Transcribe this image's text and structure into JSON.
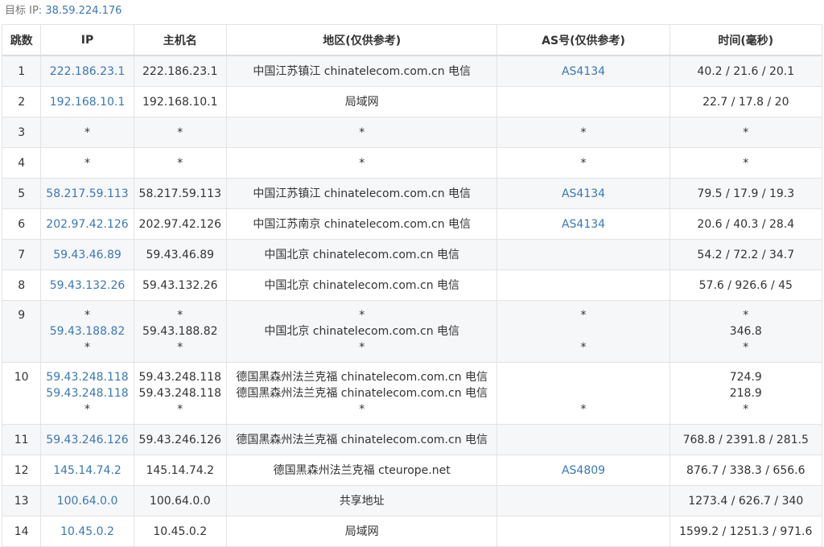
{
  "target": {
    "label": "目标 IP:",
    "ip": "38.59.224.176"
  },
  "columns": {
    "hop": "跳数",
    "ip": "IP",
    "host": "主机名",
    "region": "地区(仅供参考)",
    "as": "AS号(仅供参考)",
    "time": "时间(毫秒)"
  },
  "hops": [
    {
      "hop": "1",
      "lines": [
        {
          "ip": "222.186.23.1",
          "host": "222.186.23.1",
          "region": "中国江苏镇江 chinatelecom.com.cn 电信",
          "as": "AS4134",
          "time": "40.2 / 21.6 / 20.1"
        }
      ]
    },
    {
      "hop": "2",
      "lines": [
        {
          "ip": "192.168.10.1",
          "host": "192.168.10.1",
          "region": "局域网",
          "as": "",
          "time": "22.7 / 17.8 / 20"
        }
      ]
    },
    {
      "hop": "3",
      "lines": [
        {
          "ip": "*",
          "host": "*",
          "region": "*",
          "as": "*",
          "time": "*"
        }
      ]
    },
    {
      "hop": "4",
      "lines": [
        {
          "ip": "*",
          "host": "*",
          "region": "*",
          "as": "*",
          "time": "*"
        }
      ]
    },
    {
      "hop": "5",
      "lines": [
        {
          "ip": "58.217.59.113",
          "host": "58.217.59.113",
          "region": "中国江苏镇江 chinatelecom.com.cn 电信",
          "as": "AS4134",
          "time": "79.5 / 17.9 / 19.3"
        }
      ]
    },
    {
      "hop": "6",
      "lines": [
        {
          "ip": "202.97.42.126",
          "host": "202.97.42.126",
          "region": "中国江苏南京 chinatelecom.com.cn 电信",
          "as": "AS4134",
          "time": "20.6 / 40.3 / 28.4"
        }
      ]
    },
    {
      "hop": "7",
      "lines": [
        {
          "ip": "59.43.46.89",
          "host": "59.43.46.89",
          "region": "中国北京 chinatelecom.com.cn 电信",
          "as": "",
          "time": "54.2 / 72.2 / 34.7"
        }
      ]
    },
    {
      "hop": "8",
      "lines": [
        {
          "ip": "59.43.132.26",
          "host": "59.43.132.26",
          "region": "中国北京 chinatelecom.com.cn 电信",
          "as": "",
          "time": "57.6 / 926.6 / 45"
        }
      ]
    },
    {
      "hop": "9",
      "lines": [
        {
          "ip": "*",
          "host": "*",
          "region": "*",
          "as": "*",
          "time": "*"
        },
        {
          "ip": "59.43.188.82",
          "host": "59.43.188.82",
          "region": "中国北京 chinatelecom.com.cn 电信",
          "as": "",
          "time": "346.8"
        },
        {
          "ip": "*",
          "host": "*",
          "region": "*",
          "as": "*",
          "time": "*"
        }
      ]
    },
    {
      "hop": "10",
      "lines": [
        {
          "ip": "59.43.248.118",
          "host": "59.43.248.118",
          "region": "德国黑森州法兰克福 chinatelecom.com.cn 电信",
          "as": "",
          "time": "724.9"
        },
        {
          "ip": "59.43.248.118",
          "host": "59.43.248.118",
          "region": "德国黑森州法兰克福 chinatelecom.com.cn 电信",
          "as": "",
          "time": "218.9"
        },
        {
          "ip": "*",
          "host": "*",
          "region": "*",
          "as": "*",
          "time": "*"
        }
      ]
    },
    {
      "hop": "11",
      "lines": [
        {
          "ip": "59.43.246.126",
          "host": "59.43.246.126",
          "region": "德国黑森州法兰克福 chinatelecom.com.cn 电信",
          "as": "",
          "time": "768.8 / 2391.8 / 281.5"
        }
      ]
    },
    {
      "hop": "12",
      "lines": [
        {
          "ip": "145.14.74.2",
          "host": "145.14.74.2",
          "region": "德国黑森州法兰克福 cteurope.net",
          "as": "AS4809",
          "time": "876.7 / 338.3 / 656.6"
        }
      ]
    },
    {
      "hop": "13",
      "lines": [
        {
          "ip": "100.64.0.0",
          "host": "100.64.0.0",
          "region": "共享地址",
          "as": "",
          "time": "1273.4 / 626.7 / 340"
        }
      ]
    },
    {
      "hop": "14",
      "lines": [
        {
          "ip": "10.45.0.2",
          "host": "10.45.0.2",
          "region": "局域网",
          "as": "",
          "time": "1599.2 / 1251.3 / 971.6"
        }
      ]
    }
  ]
}
